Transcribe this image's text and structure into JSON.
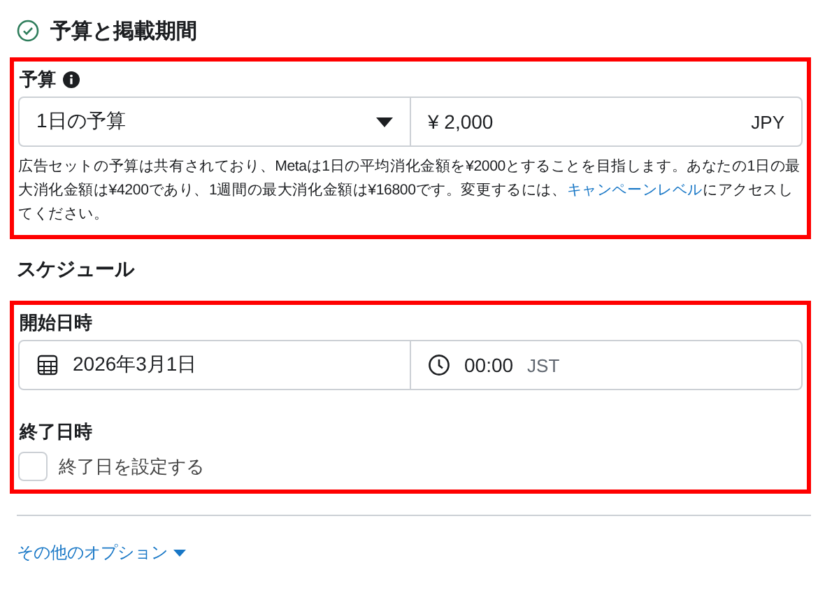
{
  "section": {
    "title": "予算と掲載期間",
    "complete": true
  },
  "budget": {
    "highlighted": true,
    "label": "予算",
    "type_select": {
      "value": "1日の予算"
    },
    "amount": {
      "value": "¥ 2,000",
      "currency": "JPY"
    },
    "help": {
      "before": "広告セットの予算は共有されており、Metaは1日の平均消化金額を¥2000とすることを目指します。あなたの1日の最大消化金額は¥4200であり、1週間の最大消化金額は¥16800です。変更するには、",
      "link": "キャンペーンレベル",
      "after": "にアクセスしてください。"
    }
  },
  "schedule": {
    "title": "スケジュール",
    "highlighted": true,
    "start_label": "開始日時",
    "start_date": "2026年3月1日",
    "start_time": "00:00",
    "timezone": "JST",
    "end_label": "終了日時",
    "end_checkbox": {
      "label": "終了日を設定する",
      "checked": false
    }
  },
  "more_options": "その他のオプション"
}
